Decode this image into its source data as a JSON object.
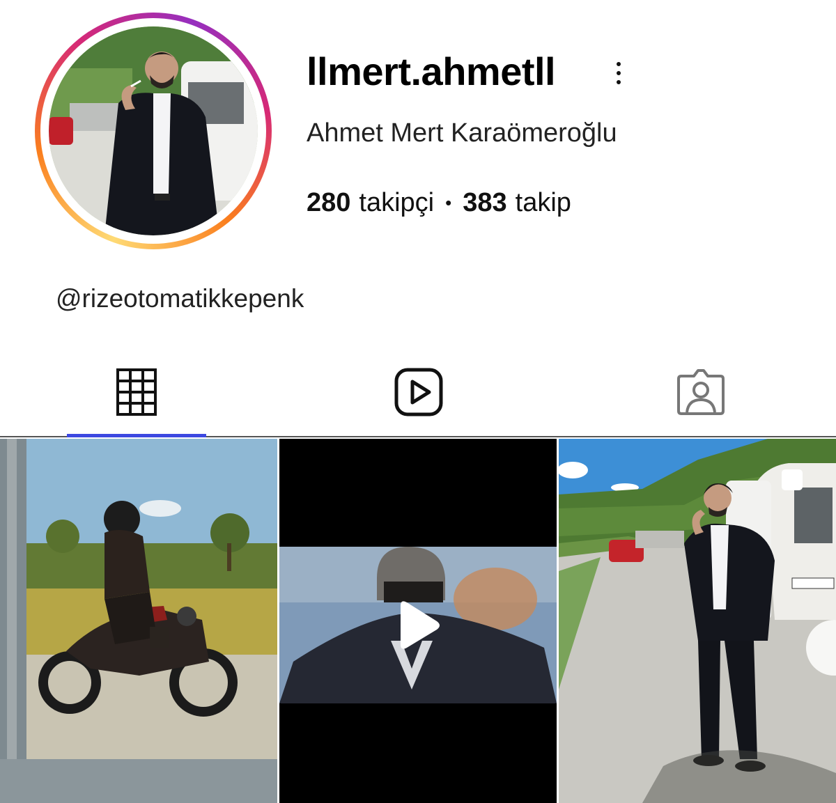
{
  "profile": {
    "username": "llmert.ahmetll",
    "full_name": "Ahmet Mert Karaömeroğlu",
    "followers_count": "280",
    "followers_label": "takipçi",
    "following_count": "383",
    "following_label": "takip",
    "separator": "•",
    "bio_mention": "@rizeotomatikkepenk"
  },
  "tabs": [
    {
      "name": "posts",
      "icon": "grid-icon",
      "active": true
    },
    {
      "name": "reels",
      "icon": "reels-icon",
      "active": false
    },
    {
      "name": "tagged",
      "icon": "tagged-person-icon",
      "active": false
    }
  ],
  "colors": {
    "active_tab_indicator": "#3c48e0",
    "story_ring_start": "#feda75",
    "story_ring_end": "#962fbf"
  },
  "posts": [
    {
      "type": "photo",
      "subject": "motorcycle-rider"
    },
    {
      "type": "reel",
      "subject": "rider-in-helmet",
      "icon": "play-icon"
    },
    {
      "type": "carousel",
      "subject": "man-in-suit-roadside",
      "icon": "multi-photo-icon"
    }
  ]
}
